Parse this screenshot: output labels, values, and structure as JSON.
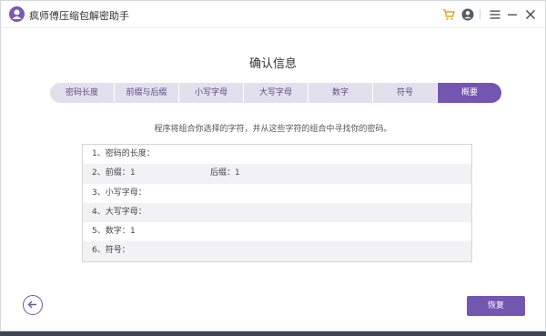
{
  "app": {
    "title": "疯师傅压缩包解密助手"
  },
  "titlebar": {
    "icons": [
      "cart-icon",
      "user-icon",
      "menu-icon",
      "minimize-icon",
      "close-icon"
    ]
  },
  "page": {
    "title": "确认信息",
    "description": "程序将组合你选择的字符，并从这些字符的组合中寻找你的密码。"
  },
  "steps": [
    {
      "label": "密码长度"
    },
    {
      "label": "前缀与后缀"
    },
    {
      "label": "小写字母"
    },
    {
      "label": "大写字母"
    },
    {
      "label": "数字"
    },
    {
      "label": "符号"
    },
    {
      "label": "概要"
    }
  ],
  "summary": {
    "rows": [
      {
        "label": "1、密码的长度：",
        "value": ""
      },
      {
        "label": "2、前缀：",
        "value": "1",
        "label2": "后缀：",
        "value2": "1"
      },
      {
        "label": "3、小写字母：",
        "value": ""
      },
      {
        "label": "4、大写字母：",
        "value": ""
      },
      {
        "label": "5、数字：",
        "value": "1"
      },
      {
        "label": "6、符号：",
        "value": ""
      }
    ]
  },
  "buttons": {
    "restore": "恢复"
  },
  "colors": {
    "accent": "#7356b0",
    "step_inactive": "#e3e0ee",
    "cart": "#e8a020"
  }
}
